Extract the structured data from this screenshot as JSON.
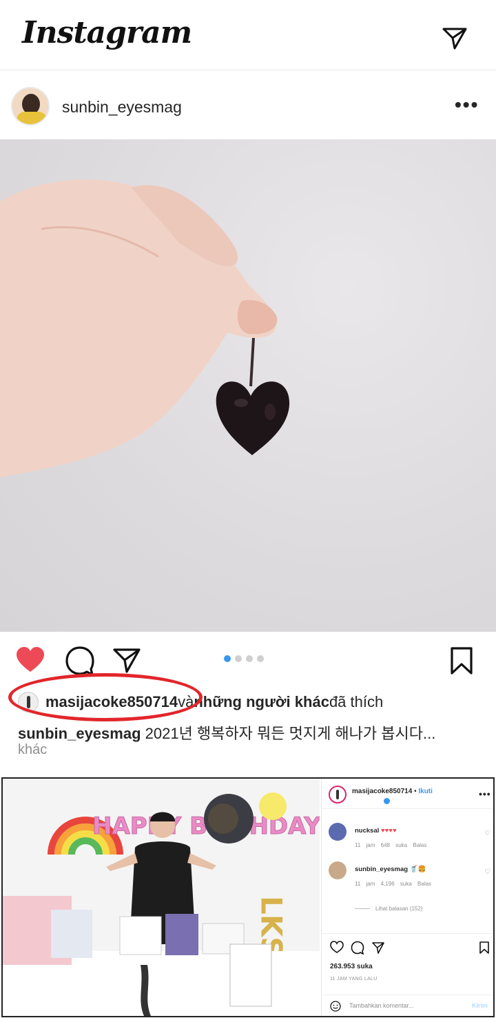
{
  "app": {
    "logo_text": "Instagram"
  },
  "post": {
    "username": "sunbin_eyesmag",
    "more_label": "•••",
    "carousel_dots": 4,
    "carousel_active": 0,
    "liked": true,
    "likes_user": "masijacoke850714",
    "likes_connector": " và ",
    "likes_others": "những người khác",
    "likes_suffix": " đã thích",
    "caption_user": "sunbin_eyesmag",
    "caption_text": " 2021년 행복하자 뭐든 멋지게 해나가 봅시다...",
    "more_text": "khác"
  },
  "embed": {
    "username": "masijacoke850714",
    "follow_separator": " • ",
    "follow_label": "Ikuti",
    "more_label": "•••",
    "comments": [
      {
        "user": "nucksal",
        "text": " ♥♥♥♥",
        "time": "11 jam",
        "likes": "648 suka",
        "reply": "Balas"
      },
      {
        "user": "sunbin_eyesmag",
        "text": " 🥤🍔",
        "time": "11 jam",
        "likes": "4,196 suka",
        "reply": "Balas"
      }
    ],
    "view_replies": "Lihat balasan (152)",
    "likes_count": "263.953 suka",
    "time_ago": "11 JAM YANG LALU",
    "comment_placeholder": "Tambahkan komentar...",
    "send_label": "Kirim",
    "balloon_letters": "HAPPY BIRTHDAY",
    "balloon_initials": "LKS"
  },
  "colors": {
    "like_red": "#ed4956",
    "link_blue": "#3897f0",
    "annotation_red": "#e2262b"
  }
}
